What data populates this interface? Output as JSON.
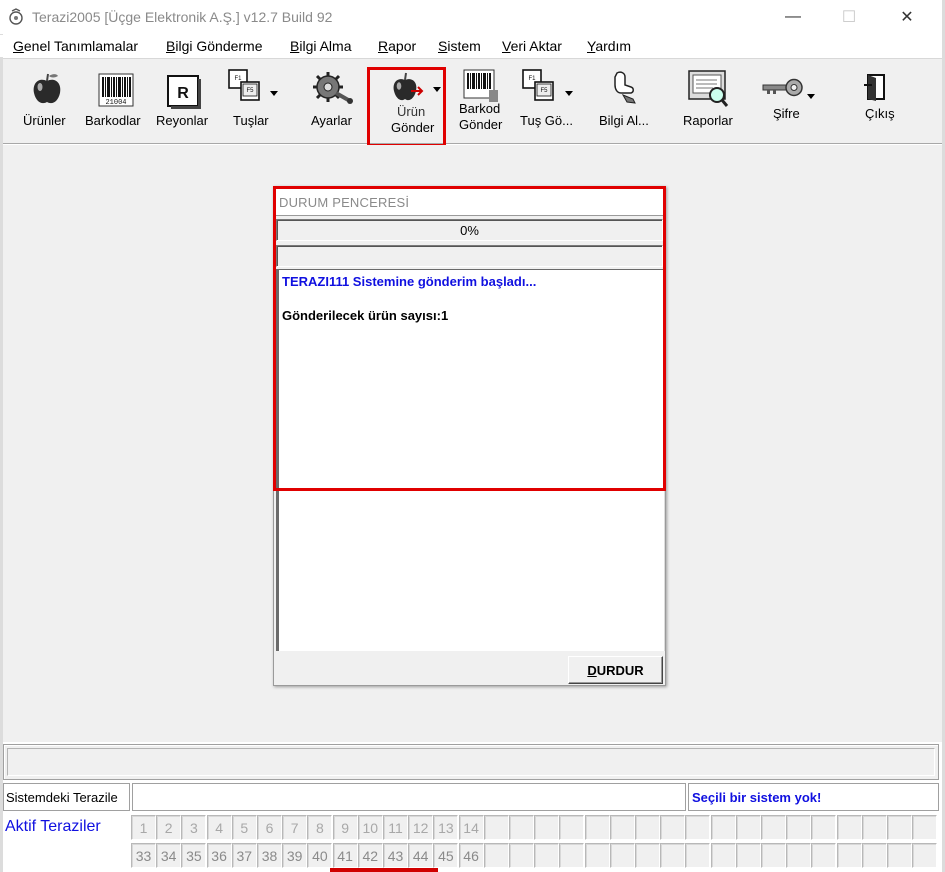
{
  "window": {
    "title": "Terazi2005 [Üçge Elektronik A.Ş.] v12.7 Build 92",
    "minimize_glyph": "—",
    "maximize_glyph": "☐",
    "close_glyph": "✕"
  },
  "menu": [
    {
      "first": "G",
      "rest": "enel Tanımlamalar"
    },
    {
      "first": "B",
      "rest": "ilgi Gönderme"
    },
    {
      "first": "B",
      "rest": "ilgi Alma"
    },
    {
      "first": "R",
      "rest": "apor"
    },
    {
      "first": "S",
      "rest": "istem"
    },
    {
      "first": "V",
      "rest": "eri Aktar"
    },
    {
      "first": "Y",
      "rest": "ardım"
    }
  ],
  "toolbar": {
    "urunler": "Ürünler",
    "barkodlar": "Barkodlar",
    "reyonlar": "Reyonlar",
    "tuslar": "Tuşlar",
    "ayarlar": "Ayarlar",
    "urun_gonder_1": "Ürün",
    "urun_gonder_2": "Gönder",
    "barkod_gonder_1": "Barkod",
    "barkod_gonder_2": "Gönder",
    "tus_gonder": "Tuş Gö...",
    "bilgi_al": "Bilgi Al...",
    "raporlar": "Raporlar",
    "sifre": "Şifre",
    "cikis": "Çıkış",
    "reyon_icon_letter": "R",
    "barcode_number": "21004"
  },
  "dialog": {
    "title": "DURUM PENCERESİ",
    "progress_text": "0%",
    "progress_value": 0,
    "log_line1": "TERAZI111 Sistemine gönderim başladı...",
    "log_line2": "Gönderilecek ürün sayısı:1",
    "stop_button_first": "D",
    "stop_button_rest": "URDUR"
  },
  "bottom": {
    "sistem_label": "Sistemdeki Terazile",
    "sistem_status": "Seçili bir sistem yok!",
    "aktif_label": "Aktif Teraziler",
    "row1": [
      "1",
      "2",
      "3",
      "4",
      "5",
      "6",
      "7",
      "8",
      "9",
      "10",
      "11",
      "12",
      "13",
      "14"
    ],
    "row2": [
      "33",
      "34",
      "35",
      "36",
      "37",
      "38",
      "39",
      "40",
      "41",
      "42",
      "43",
      "44",
      "45",
      "46"
    ]
  },
  "colors": {
    "highlight": "#e00000",
    "link_blue": "#1010e0",
    "window_bg": "#f0f0f0"
  }
}
